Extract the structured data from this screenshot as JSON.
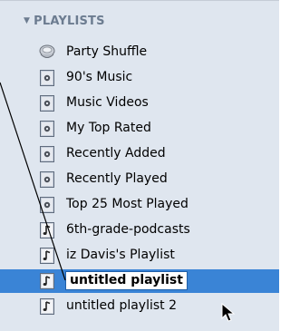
{
  "sidebar": {
    "header": "PLAYLISTS",
    "items": [
      {
        "label": "Party Shuffle",
        "icon": "party-shuffle-icon"
      },
      {
        "label": "90's Music",
        "icon": "smart-playlist-icon"
      },
      {
        "label": "Music Videos",
        "icon": "smart-playlist-icon"
      },
      {
        "label": "My Top Rated",
        "icon": "smart-playlist-icon"
      },
      {
        "label": "Recently Added",
        "icon": "smart-playlist-icon"
      },
      {
        "label": "Recently Played",
        "icon": "smart-playlist-icon"
      },
      {
        "label": "Top 25 Most Played",
        "icon": "smart-playlist-icon"
      },
      {
        "label": "6th-grade-podcasts",
        "icon": "playlist-icon"
      },
      {
        "label": "iz Davis's Playlist",
        "icon": "playlist-icon"
      },
      {
        "label": "untitled playlist",
        "icon": "playlist-icon",
        "selected": true,
        "editing": true
      },
      {
        "label": "untitled playlist 2",
        "icon": "playlist-icon"
      }
    ]
  },
  "colors": {
    "sidebar_bg": "#dfe6ef",
    "selection": "#3a84d6",
    "header_text": "#6c7c90"
  }
}
